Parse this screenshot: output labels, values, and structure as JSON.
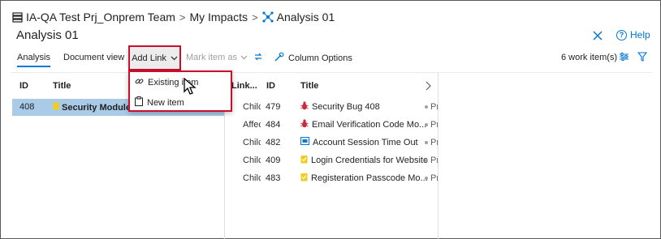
{
  "breadcrumb": {
    "project": "IA-QA Test Prj_Onprem Team",
    "separator": ">",
    "section": "My Impacts",
    "current": "Analysis 01"
  },
  "page": {
    "title": "Analysis 01",
    "help_label": "Help"
  },
  "toolbar": {
    "tabs": [
      {
        "label": "Analysis"
      },
      {
        "label": "Document view"
      }
    ],
    "add_link_label": "Add Link",
    "mark_item_label": "Mark item as",
    "column_options_label": "Column Options",
    "work_item_count": "6 work item(s)"
  },
  "add_link_menu": {
    "items": [
      {
        "label": "Existing item"
      },
      {
        "label": "New item"
      }
    ]
  },
  "left_grid": {
    "headers": {
      "id": "ID",
      "title": "Title"
    },
    "rows": [
      {
        "id": "408",
        "title": "Security Module fo"
      }
    ]
  },
  "right_grid": {
    "headers": {
      "link": "Link...",
      "id": "ID",
      "title": "Title"
    },
    "rows": [
      {
        "link": "Chilc",
        "id": "479",
        "title": "Security Bug 408",
        "type": "bug",
        "state": "Pr"
      },
      {
        "link": "Affec",
        "id": "484",
        "title": "Email Verification Code Mo...",
        "type": "bug",
        "state": "Pr"
      },
      {
        "link": "Chilc",
        "id": "482",
        "title": "Account Session Time Out",
        "type": "task",
        "state": "Pr"
      },
      {
        "link": "Chilc",
        "id": "409",
        "title": "Login Credentials for Website",
        "type": "story",
        "state": "Pr"
      },
      {
        "link": "Chilc",
        "id": "483",
        "title": "Registeration Passcode Mo...",
        "type": "story",
        "state": "Pr"
      }
    ]
  },
  "colors": {
    "accent": "#0078d4",
    "selected_row": "#a9cbe8",
    "highlight_border": "#c8102e",
    "bug": "#cc293d",
    "story": "#f2cb1d",
    "task": "#0078d4"
  }
}
